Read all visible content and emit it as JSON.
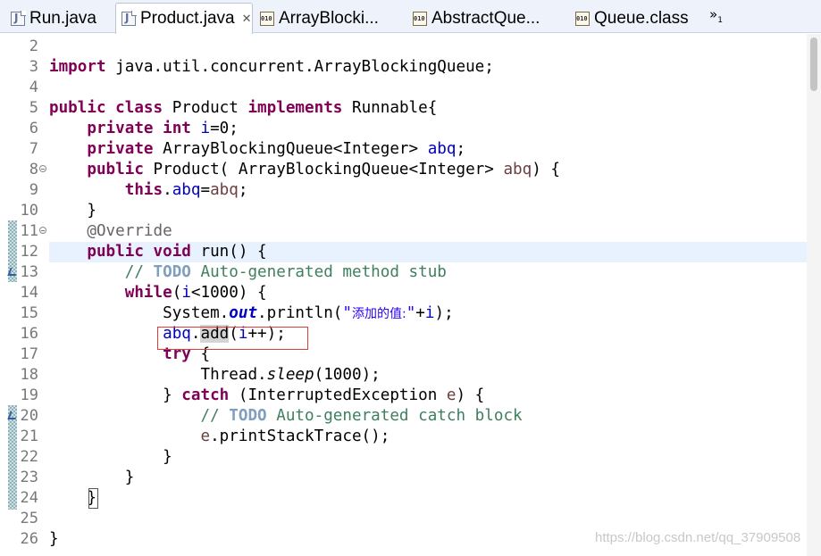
{
  "tabs": [
    {
      "label": "Run.java",
      "icon": "java-file-icon",
      "active": false
    },
    {
      "label": "Product.java",
      "icon": "java-file-icon",
      "active": true,
      "close": "✕"
    },
    {
      "label": "ArrayBlocki...",
      "icon": "class-file-icon",
      "active": false
    },
    {
      "label": "AbstractQue...",
      "icon": "class-file-icon",
      "active": false
    },
    {
      "label": "Queue.class",
      "icon": "class-file-icon",
      "active": false
    }
  ],
  "tab_overflow": {
    "symbol": "»",
    "count": "1"
  },
  "line_numbers": [
    "2",
    "3",
    "4",
    "5",
    "6",
    "7",
    "8",
    "9",
    "10",
    "11",
    "12",
    "13",
    "14",
    "15",
    "16",
    "17",
    "18",
    "19",
    "20",
    "21",
    "22",
    "23",
    "24",
    "25",
    "26"
  ],
  "code": {
    "l3_import": "import",
    "l3_rest": " java.util.concurrent.ArrayBlockingQueue;",
    "l5_public": "public",
    "l5_class": "class",
    "l5_name": " Product ",
    "l5_implements": "implements",
    "l5_rest": " Runnable{",
    "l6_private": "private",
    "l6_int": "int",
    "l6_var": "i",
    "l6_rest": "=0;",
    "l7_private": "private",
    "l7_type": " ArrayBlockingQueue<Integer> ",
    "l7_var": "abq",
    "l7_end": ";",
    "l8_public": "public",
    "l8_sig": " Product( ArrayBlockingQueue<Integer> ",
    "l8_param": "abq",
    "l8_end": ") {",
    "l9_this": "this",
    "l9_dot": ".",
    "l9_field": "abq",
    "l9_eq": "=",
    "l9_param": "abq",
    "l9_end": ";",
    "l10": "}",
    "l11_ann": "@Override",
    "l12_public": "public",
    "l12_void": "void",
    "l12_rest": " run() {",
    "l13_cmt1": "// ",
    "l13_todo": "TODO",
    "l13_cmt2": " Auto-generated method stub",
    "l14_while": "while",
    "l14_open": "(",
    "l14_var": "i",
    "l14_rest": "<1000) {",
    "l15_sys": "System.",
    "l15_out": "out",
    "l15_println": ".println(",
    "l15_str1": "\"",
    "l15_str_cjk": "添加的值:",
    "l15_str2": "\"",
    "l15_plus": "+",
    "l15_var": "i",
    "l15_end": ");",
    "l16_field": "abq",
    "l16_dot": ".",
    "l16_add": "add",
    "l16_open": "(",
    "l16_var": "i",
    "l16_end": "++);",
    "l17_try": "try",
    "l17_rest": " {",
    "l18_thread": "Thread.",
    "l18_sleep": "sleep",
    "l18_rest": "(1000);",
    "l19_close": "} ",
    "l19_catch": "catch",
    "l19_rest1": " (InterruptedException ",
    "l19_e": "e",
    "l19_rest2": ") {",
    "l20_cmt1": "// ",
    "l20_todo": "TODO",
    "l20_cmt2": " Auto-generated catch block",
    "l21_e": "e",
    "l21_rest": ".printStackTrace();",
    "l22": "}",
    "l23": "}",
    "l24": "}",
    "l26": "}"
  },
  "watermark": "https://blog.csdn.net/qq_37909508",
  "colors": {
    "keyword": "#7f0055",
    "field": "#0000c0",
    "comment": "#3f7f5f",
    "todo": "#7f9fbf",
    "string": "#2a00ff",
    "annotation": "#646464",
    "current_line": "#e8f2fe",
    "highlight_box": "#e03a3a"
  }
}
